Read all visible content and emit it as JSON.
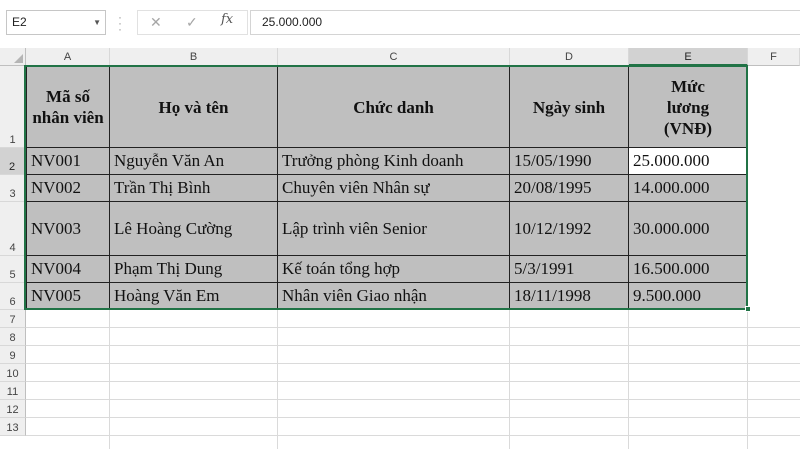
{
  "name_box": {
    "value": "E2"
  },
  "formula_bar": {
    "cancel_icon": "✕",
    "enter_icon": "✓",
    "fx_label": "fx",
    "value": "25.000.000"
  },
  "columns": [
    "A",
    "B",
    "C",
    "D",
    "E",
    "F"
  ],
  "rows": [
    "1",
    "2",
    "3",
    "4",
    "5",
    "6",
    "7",
    "8",
    "9",
    "10",
    "11",
    "12",
    "13"
  ],
  "table": {
    "headers": [
      "Mã số nhân viên",
      "Họ và tên",
      "Chức danh",
      "Ngày sinh",
      "Mức lương (VNĐ)"
    ],
    "rows": [
      [
        "NV001",
        "Nguyễn Văn An",
        "Trưởng phòng Kinh doanh",
        "15/05/1990",
        "25.000.000"
      ],
      [
        "NV002",
        "Trần Thị Bình",
        "Chuyên viên Nhân sự",
        "20/08/1995",
        "14.000.000"
      ],
      [
        "NV003",
        "Lê Hoàng Cường",
        "Lập trình viên Senior",
        "10/12/1992",
        "30.000.000"
      ],
      [
        "NV004",
        "Phạm Thị Dung",
        "Kế toán tổng hợp",
        "5/3/1991",
        "16.500.000"
      ],
      [
        "NV005",
        "Hoàng Văn Em",
        "Nhân viên Giao nhận",
        "18/11/1998",
        "9.500.000"
      ]
    ]
  },
  "colors": {
    "selection": "#217346",
    "cell_fill": "#bfbfbf",
    "header_bg": "#efefef"
  }
}
